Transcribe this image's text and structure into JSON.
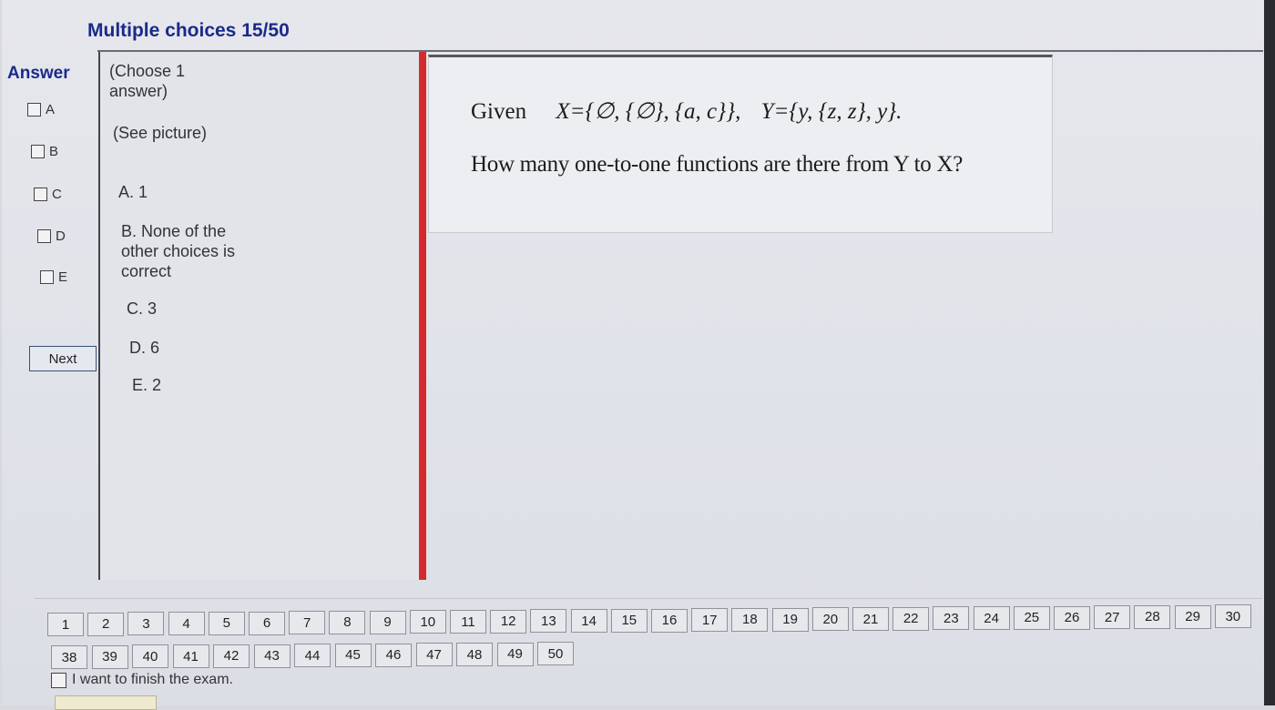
{
  "header": {
    "title": "Multiple choices 15/50"
  },
  "answer": {
    "label": "Answer",
    "options": [
      "A",
      "B",
      "C",
      "D",
      "E"
    ],
    "next_label": "Next"
  },
  "choices": {
    "instruction": "(Choose 1 answer)",
    "see_picture": "(See picture)",
    "items": [
      "A. 1",
      "B. None of the other choices is correct",
      "C. 3",
      "D. 6",
      "E. 2"
    ]
  },
  "question": {
    "given_word": "Given",
    "x_set": "X={∅, {∅}, {a, c}},",
    "y_set": "Y={y, {z, z}, y}.",
    "prompt": "How many one-to-one functions are there from Y to X?"
  },
  "navigation": {
    "row1": [
      "1",
      "2",
      "3",
      "4",
      "5",
      "6",
      "7",
      "8",
      "9",
      "10",
      "11",
      "12",
      "13",
      "14",
      "15",
      "16",
      "17",
      "18",
      "19",
      "20",
      "21",
      "22",
      "23",
      "24",
      "25",
      "26",
      "27",
      "28",
      "29",
      "30"
    ],
    "row2": [
      "38",
      "39",
      "40",
      "41",
      "42",
      "43",
      "44",
      "45",
      "46",
      "47",
      "48",
      "49",
      "50"
    ]
  },
  "finish": {
    "label": "I want to finish the exam."
  }
}
